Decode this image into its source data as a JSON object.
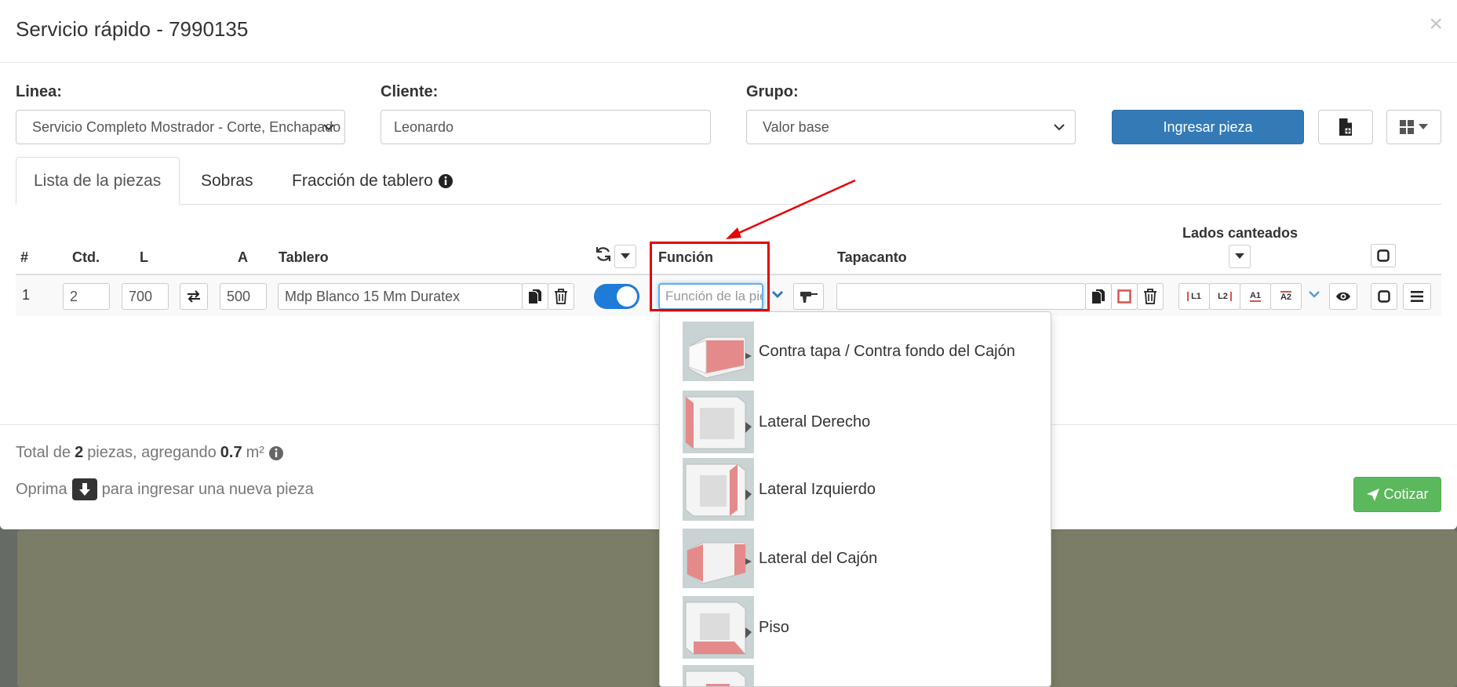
{
  "modal": {
    "title": "Servicio rápido - 7990135",
    "close": "×"
  },
  "form": {
    "linea_label": "Linea:",
    "linea_value": "Servicio Completo Mostrador - Corte, Enchapado",
    "cliente_label": "Cliente:",
    "cliente_value": "Leonardo",
    "grupo_label": "Grupo:",
    "grupo_value": "Valor base",
    "ingresar_label": "Ingresar pieza"
  },
  "tabs": [
    {
      "label": "Lista de la piezas",
      "active": true
    },
    {
      "label": "Sobras",
      "active": false
    },
    {
      "label": "Fracción de tablero",
      "active": false
    }
  ],
  "table": {
    "headers": {
      "num": "#",
      "ctd": "Ctd.",
      "l": "L",
      "a": "A",
      "tablero": "Tablero",
      "funcion": "Función",
      "tapacanto": "Tapacanto",
      "lados": "Lados canteados"
    },
    "row": {
      "num": "1",
      "ctd": "2",
      "l": "700",
      "a": "500",
      "tablero": "Mdp Blanco 15 Mm Duratex",
      "funcion_placeholder": "Función de la pieza",
      "tapacanto": "",
      "edge_buttons": [
        "L1",
        "L2",
        "A1",
        "A2"
      ]
    }
  },
  "footer": {
    "total_prefix": "Total de",
    "total_count": "2",
    "total_mid": "piezas, agregando",
    "total_area": "0.7",
    "total_unit": "m²",
    "hint_prefix": "Oprima",
    "hint_suffix": "para ingresar una nueva pieza",
    "cotizar_label": "Cotizar"
  },
  "dropdown": {
    "items": [
      "Contra tapa / Contra fondo del Cajón",
      "Lateral Derecho",
      "Lateral Izquierdo",
      "Lateral del Cajón",
      "Piso",
      ""
    ]
  },
  "colors": {
    "primary": "#337ab7",
    "success": "#5cb85c",
    "highlight": "#e60000",
    "toggle": "#1e7bd8",
    "edge_red": "#d9534f"
  },
  "icons": {
    "close": "close-icon",
    "new_doc": "file-icon",
    "grid": "grid-icon",
    "info": "info-icon",
    "swap": "swap-icon",
    "copy": "copy-icon",
    "trash": "trash-icon",
    "refresh": "refresh-icon",
    "drill": "drill-icon",
    "eye": "eye-icon",
    "menu": "menu-icon",
    "send": "paper-plane-icon"
  }
}
